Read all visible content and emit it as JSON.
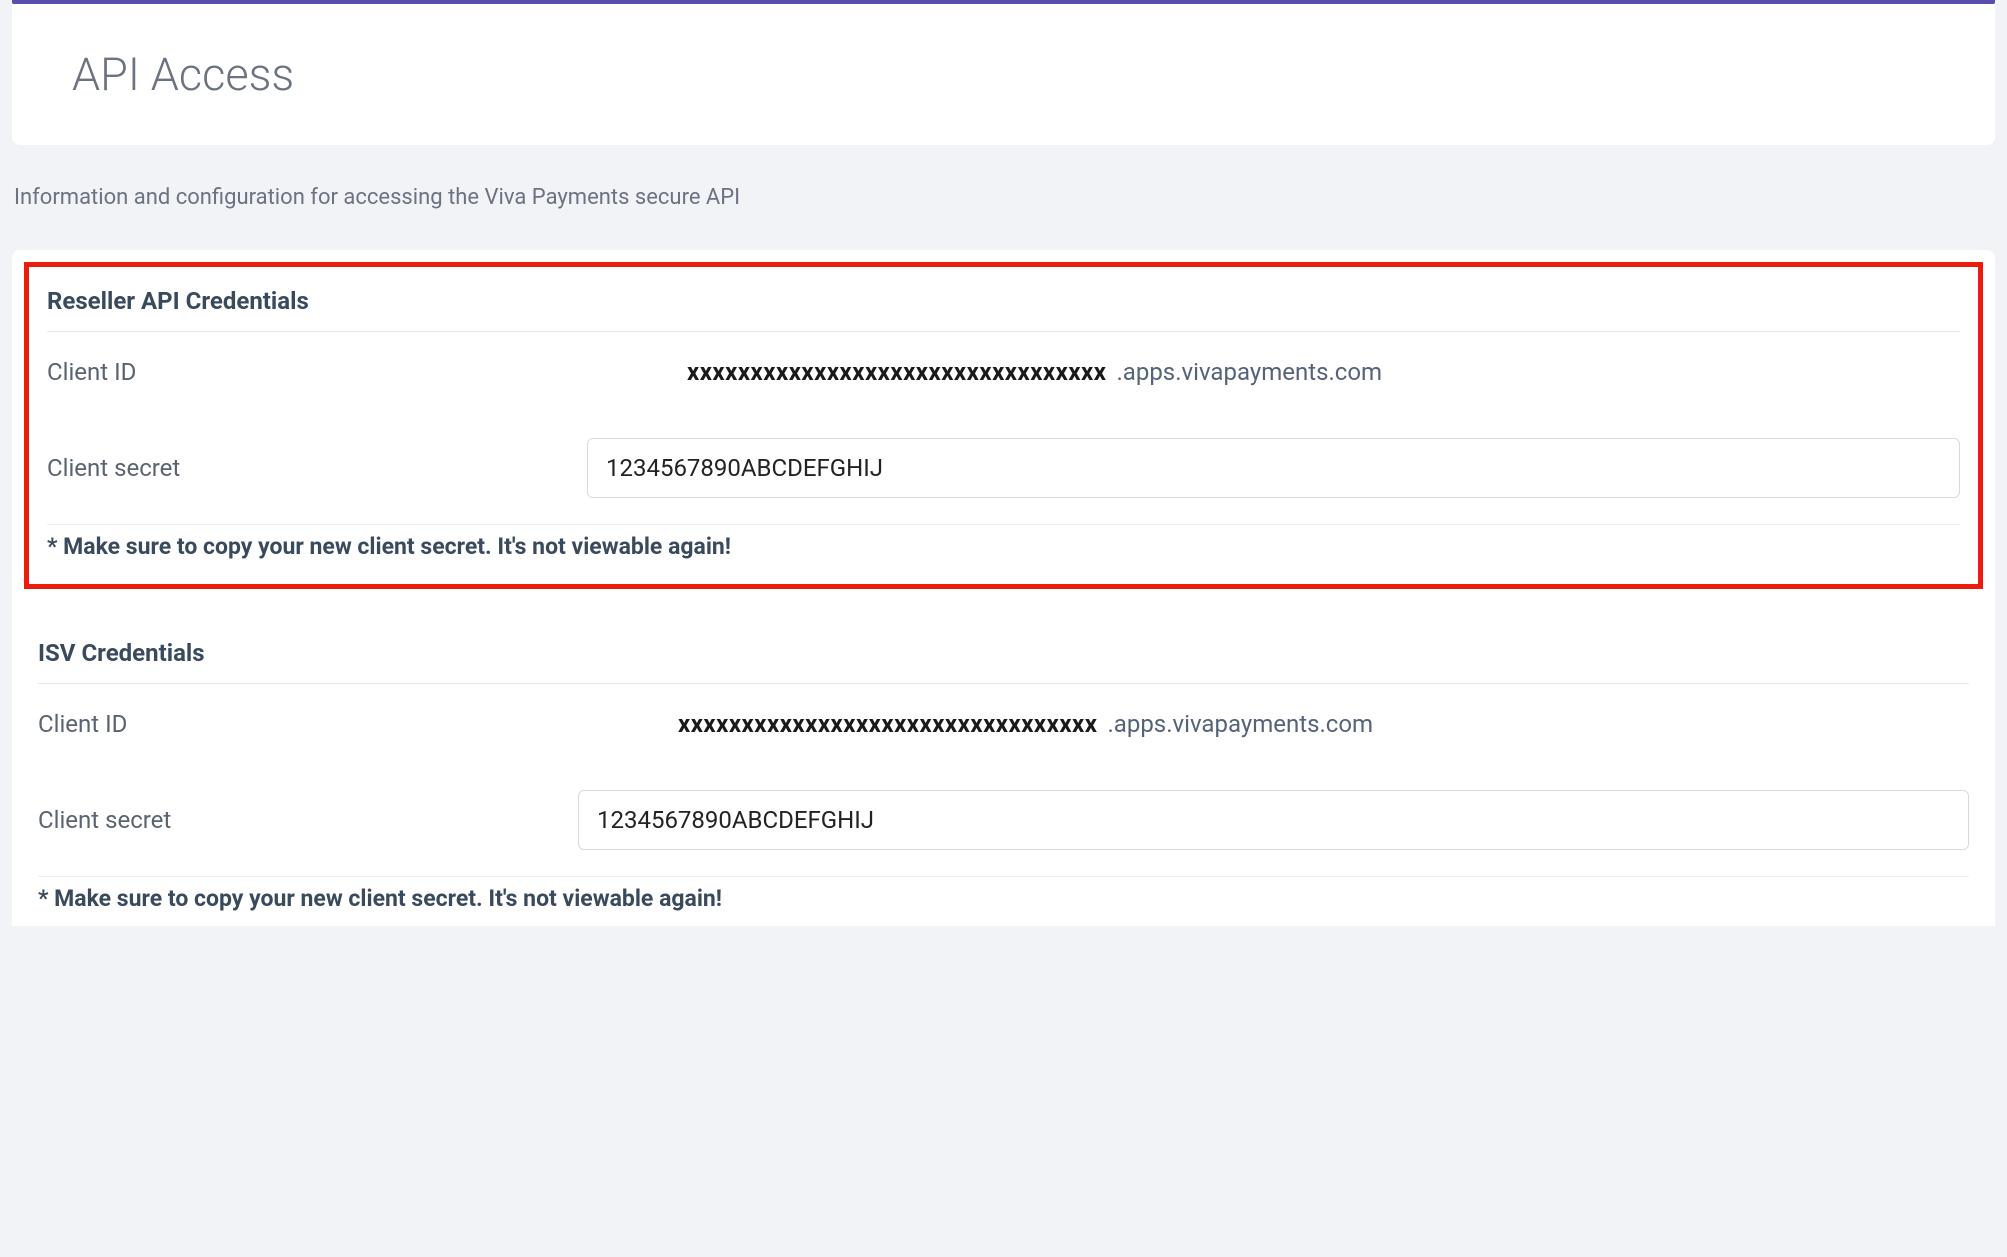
{
  "header": {
    "title": "API Access"
  },
  "description": "Information and configuration for accessing the Viva Payments secure API",
  "sections": {
    "reseller": {
      "title": "Reseller API Credentials",
      "client_id_label": "Client ID",
      "client_id_value": "xxxxxxxxxxxxxxxxxxxxxxxxxxxxxxxxx",
      "client_id_suffix": ".apps.vivapayments.com",
      "client_secret_label": "Client secret",
      "client_secret_value": "1234567890ABCDEFGHIJ",
      "warning": "* Make sure to copy your new client secret. It's not viewable again!"
    },
    "isv": {
      "title": "ISV Credentials",
      "client_id_label": "Client ID",
      "client_id_value": "xxxxxxxxxxxxxxxxxxxxxxxxxxxxxxxxx",
      "client_id_suffix": ".apps.vivapayments.com",
      "client_secret_label": "Client secret",
      "client_secret_value": "1234567890ABCDEFGHIJ",
      "warning": "* Make sure to copy your new client secret. It's not viewable again!"
    }
  }
}
